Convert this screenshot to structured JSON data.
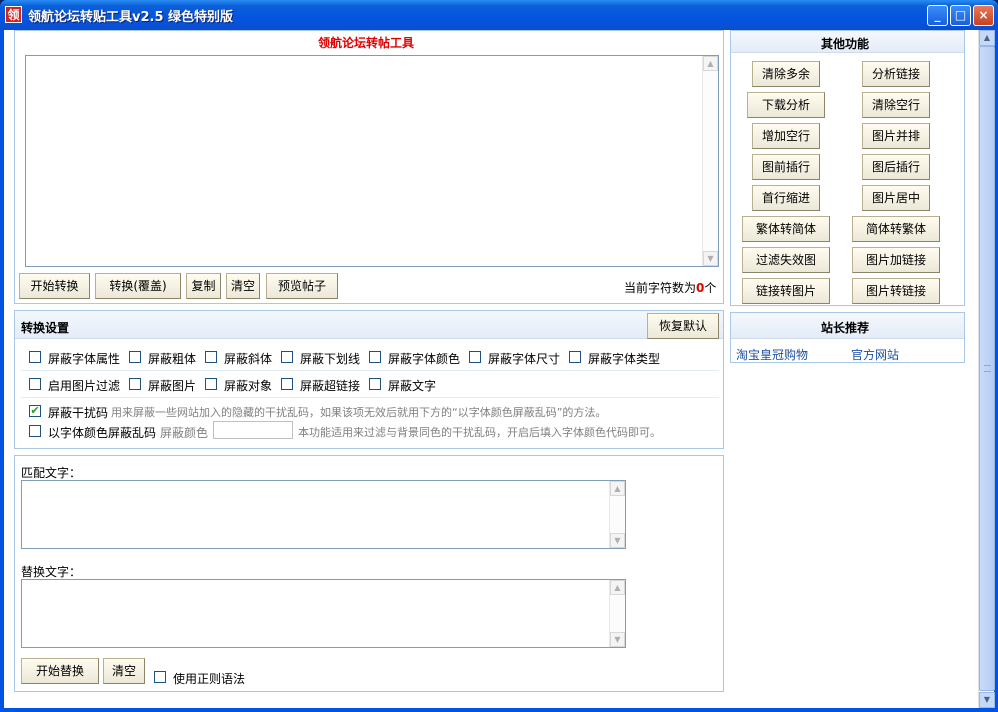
{
  "window": {
    "title": "领航论坛转贴工具v2.5 绿色特别版",
    "icon_char": "领",
    "buttons": {
      "minimize": "_",
      "maximize": "□",
      "close": "×"
    }
  },
  "main": {
    "heading": "领航论坛转帖工具",
    "buttons": [
      "开始转换",
      "转换(覆盖)",
      "复制",
      "清空",
      "预览帖子"
    ],
    "char_count_label": "当前字符数为",
    "char_count_value": "0",
    "char_count_unit": "个"
  },
  "settings": {
    "title": "转换设置",
    "restore_button": "恢复默认",
    "row1": [
      "屏蔽字体属性",
      "屏蔽粗体",
      "屏蔽斜体",
      "屏蔽下划线",
      "屏蔽字体颜色",
      "屏蔽字体尺寸",
      "屏蔽字体类型"
    ],
    "row2": [
      "启用图片过滤",
      "屏蔽图片",
      "屏蔽对象",
      "屏蔽超链接",
      "屏蔽文字"
    ],
    "interference": {
      "label": "屏蔽干扰码",
      "checked_mark": "✔",
      "desc": "用来屏蔽一些网站加入的隐藏的干扰乱码，如果该项无效后就用下方的“以字体颜色屏蔽乱码”的方法。"
    },
    "color_filter": {
      "label": "以字体颜色屏蔽乱码",
      "color_label": "屏蔽颜色",
      "color_value": "",
      "desc": "本功能适用来过滤与背景同色的干扰乱码，开启后填入字体颜色代码即可。"
    }
  },
  "replace": {
    "match_label": "匹配文字：",
    "replace_label": "替换文字：",
    "start_button": "开始替换",
    "clear_button": "清空",
    "regex_label": "使用正则语法"
  },
  "other": {
    "title": "其他功能",
    "buttons": [
      "清除多余",
      "分析链接",
      "下载分析",
      "清除空行",
      "增加空行",
      "图片并排",
      "图前插行",
      "图后插行",
      "首行缩进",
      "图片居中",
      "繁体转简体",
      "简体转繁体",
      "过滤失效图",
      "图片加链接",
      "链接转图片",
      "图片转链接"
    ]
  },
  "recommend": {
    "title": "站长推荐",
    "links": [
      "淘宝皇冠购物",
      "官方网站"
    ]
  },
  "scroll": {
    "up": "▲",
    "down": "▼"
  }
}
